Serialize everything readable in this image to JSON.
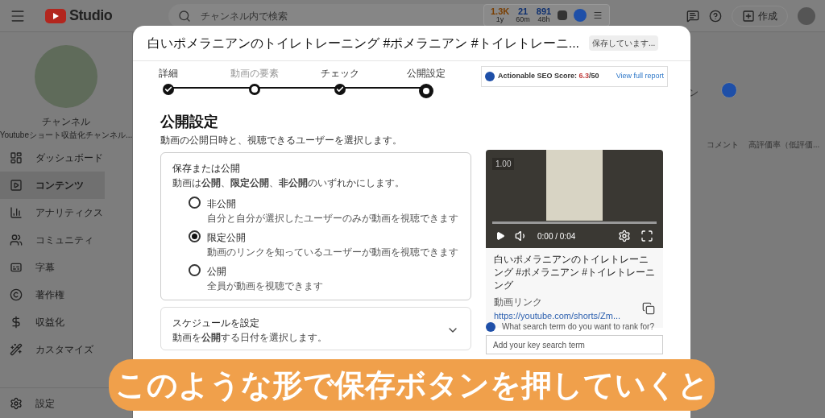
{
  "topbar": {
    "logo": "Studio",
    "search": {
      "placeholder": "チャンネル内で検索"
    },
    "stats": [
      {
        "value": "1.3K",
        "label": "1y",
        "color": "#7a3e00"
      },
      {
        "value": "21",
        "label": "60m",
        "color": "#0d2f70"
      },
      {
        "value": "891",
        "label": "48h",
        "color": "#0d2f70"
      }
    ],
    "create_button": "作成"
  },
  "sidebar": {
    "channel_name": "チャンネル",
    "channel_description": "Youtubeショート収益化チャンネル...",
    "items": [
      {
        "label": "ダッシュボード",
        "selected": false
      },
      {
        "label": "コンテンツ",
        "selected": true
      },
      {
        "label": "アナリティクス",
        "selected": false
      },
      {
        "label": "コミュニティ",
        "selected": false
      },
      {
        "label": "字幕",
        "selected": false
      },
      {
        "label": "著作権",
        "selected": false
      },
      {
        "label": "収益化",
        "selected": false
      },
      {
        "label": "カスタマイズ",
        "selected": false
      }
    ],
    "settings": "設定"
  },
  "background": {
    "column_1": "ン",
    "columns": [
      "コメント",
      "高評価率（低評価..."
    ]
  },
  "dialog": {
    "title": "白いポメラニアンのトイレトレーニング #ポメラニアン #トイレトレーニ...",
    "saving_badge": "保存しています...",
    "steps": [
      {
        "label": "詳細",
        "done": true,
        "current": false
      },
      {
        "label": "動画の要素",
        "done": false,
        "current": false
      },
      {
        "label": "チェック",
        "done": true,
        "current": false
      },
      {
        "label": "公開設定",
        "done": false,
        "current": true
      }
    ],
    "seo": {
      "label": "Actionable SEO Score:",
      "score": "6.3",
      "max": "/50",
      "link": "View full report"
    },
    "heading": "公開設定",
    "subheading": "動画の公開日時と、視聴できるユーザーを選択します。",
    "save_or_publish": {
      "title": "保存または公開",
      "description": "動画は**公開**、**限定公開**、**非公開**のいずれかにします。",
      "options": [
        {
          "label": "非公開",
          "description": "自分と自分が選択したユーザーのみが動画を視聴できます",
          "selected": false
        },
        {
          "label": "限定公開",
          "description": "動画のリンクを知っているユーザーが動画を視聴できます",
          "selected": true
        },
        {
          "label": "公開",
          "description": "全員が動画を視聴できます",
          "selected": false
        }
      ]
    },
    "schedule": {
      "title": "スケジュールを設定",
      "description": "動画を**公開**する日付を選択します。",
      "expanded": false
    },
    "preview": {
      "timestamp": "1.00",
      "time": "0:00 / 0:04",
      "title": "白いポメラニアンのトイレトレーニング #ポメラニアン #トイレトレーニング",
      "link_label": "動画リンク",
      "link": "https://youtube.com/shorts/Zm..."
    },
    "keyword": {
      "question": "What search term do you want to rank for?",
      "placeholder": "Add your key search term"
    }
  },
  "caption": "このような形で保存ボタンを押していくと"
}
